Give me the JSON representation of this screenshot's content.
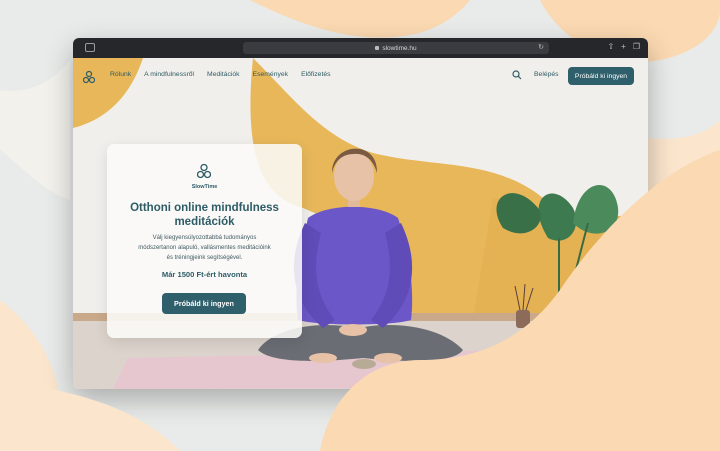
{
  "browser": {
    "url": "slowtime.hu"
  },
  "nav": {
    "links": [
      "Rólunk",
      "A mindfulnessről",
      "Meditációk",
      "Események",
      "Előfizetés"
    ],
    "login": "Belépés",
    "cta": "Próbáld ki ingyen"
  },
  "hero": {
    "brand": "SlowTime",
    "title_line1": "Otthoni online mindfulness",
    "title_line2": "meditációk",
    "desc_line1": "Válj kiegyensúlyozottabbá tudományos",
    "desc_line2": "módszertanon alapuló, vallásmentes meditációink",
    "desc_line3": "és tréningjeink segítségével.",
    "price": "Már 1500 Ft-ért havonta",
    "cta": "Próbáld ki ingyen"
  },
  "colors": {
    "accent": "#2f5f6b",
    "wall_yellow": "#e7b75a",
    "sweater": "#6b57c7",
    "backdrop_peach": "#fbd9b2"
  }
}
